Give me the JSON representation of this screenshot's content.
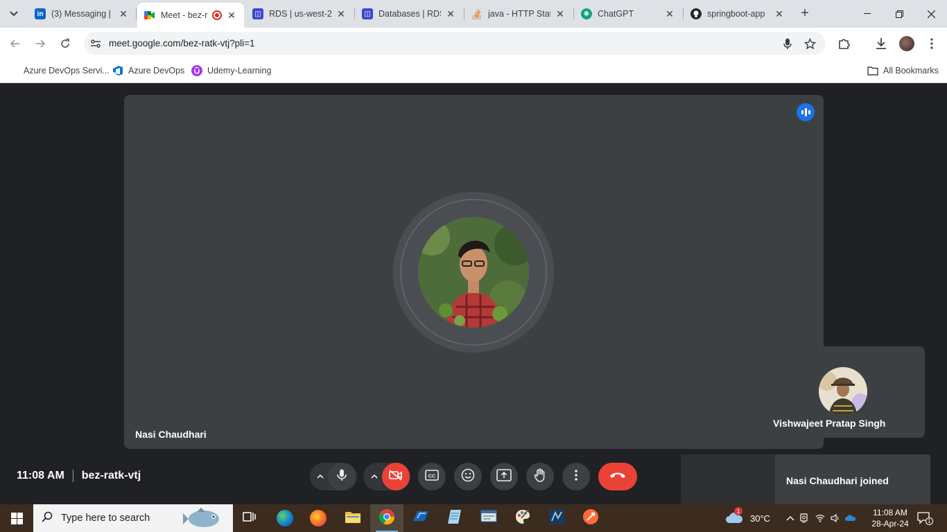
{
  "browser": {
    "tabs": [
      {
        "title": "(3) Messaging | L",
        "favicon": "linkedin-icon",
        "color": "#0a66c2"
      },
      {
        "title": "Meet - bez-r",
        "favicon": "google-meet-icon",
        "color": "#00897b",
        "active": true
      },
      {
        "title": "RDS | us-west-2",
        "favicon": "aws-rds-icon",
        "color": "#3b48cc"
      },
      {
        "title": "Databases | RDS",
        "favicon": "aws-rds-icon",
        "color": "#3b48cc"
      },
      {
        "title": "java - HTTP Stat",
        "favicon": "stackoverflow-icon",
        "color": "#f48024"
      },
      {
        "title": "ChatGPT",
        "favicon": "chatgpt-icon",
        "color": "#10a37f"
      },
      {
        "title": "springboot-app",
        "favicon": "github-icon",
        "color": "#24292e"
      }
    ],
    "url": "meet.google.com/bez-ratk-vtj?pli=1",
    "bookmarks": [
      {
        "label": "Azure DevOps Servi...",
        "icon": "microsoft-icon"
      },
      {
        "label": "Azure DevOps",
        "icon": "azure-devops-icon"
      },
      {
        "label": "Udemy-Learning",
        "icon": "udemy-icon"
      }
    ],
    "all_bookmarks": "All Bookmarks"
  },
  "meet": {
    "main_participant": "Nasi Chaudhari",
    "self_participant": "Vishwajeet Pratap Singh",
    "time": "11:08 AM",
    "meeting_code": "bez-ratk-vtj",
    "toast": "Nasi Chaudhari joined",
    "colors": {
      "hangup": "#ea4335",
      "speaking": "#1a73e8",
      "tile": "#3c4043",
      "background": "#202124"
    }
  },
  "taskbar": {
    "search_placeholder": "Type here to search",
    "weather_temp": "30°C",
    "weather_badge": "1",
    "clock_time": "11:08 AM",
    "clock_date": "28-Apr-24",
    "notification_count": "1"
  }
}
